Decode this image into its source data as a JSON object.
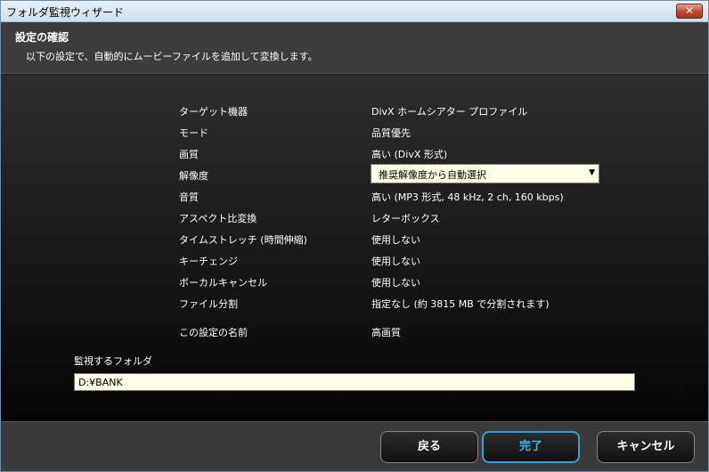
{
  "window": {
    "title": "フォルダ監視ウィザード",
    "close_label": "✕"
  },
  "header": {
    "title": "設定の確認",
    "description": "以下の設定で、自動的にムービーファイルを追加して変換します。"
  },
  "settings": [
    {
      "label": "ターゲット機器",
      "value": "DivX ホームシアター プロファイル"
    },
    {
      "label": "モード",
      "value": "品質優先"
    },
    {
      "label": "画質",
      "value": "高い (DivX 形式)"
    },
    {
      "label": "解像度",
      "value": "推奨解像度から自動選択"
    },
    {
      "label": "音質",
      "value": "高い (MP3 形式, 48 kHz, 2 ch, 160 kbps)"
    },
    {
      "label": "アスペクト比変換",
      "value": "レターボックス"
    },
    {
      "label": "タイムストレッチ (時間伸縮)",
      "value": "使用しない"
    },
    {
      "label": "キーチェンジ",
      "value": "使用しない"
    },
    {
      "label": "ボーカルキャンセル",
      "value": "使用しない"
    },
    {
      "label": "ファイル分割",
      "value": "指定なし (約 3815 MB で分割されます)"
    },
    {
      "label": "この設定の名前",
      "value": "高画質"
    }
  ],
  "folder": {
    "label": "監視するフォルダ",
    "value": "D:¥BANK"
  },
  "footer": {
    "back_label": "戻る",
    "finish_label": "完了",
    "cancel_label": "キャンセル"
  }
}
